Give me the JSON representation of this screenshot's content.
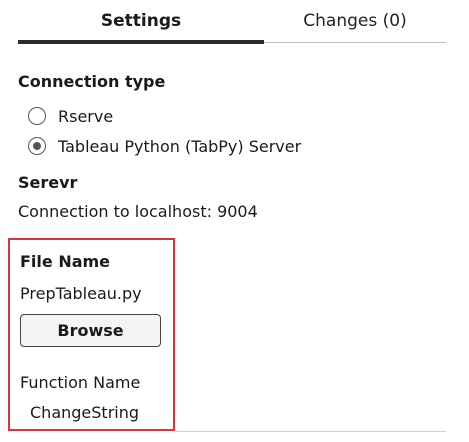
{
  "tabs": {
    "settings": "Settings",
    "changes": "Changes (0)"
  },
  "connection": {
    "heading": "Connection type",
    "options": [
      {
        "label": "Rserve",
        "selected": false
      },
      {
        "label": "Tableau Python (TabPy) Server",
        "selected": true
      }
    ]
  },
  "server": {
    "heading": "Serevr",
    "value": "Connection to localhost: 9004"
  },
  "file": {
    "heading": "File Name",
    "value": "PrepTableau.py",
    "browse_label": "Browse"
  },
  "function": {
    "heading": "Function Name",
    "value": "ChangeString"
  },
  "colors": {
    "highlight_border": "#d9343d",
    "active_tab_underline": "#2b2b2b"
  }
}
